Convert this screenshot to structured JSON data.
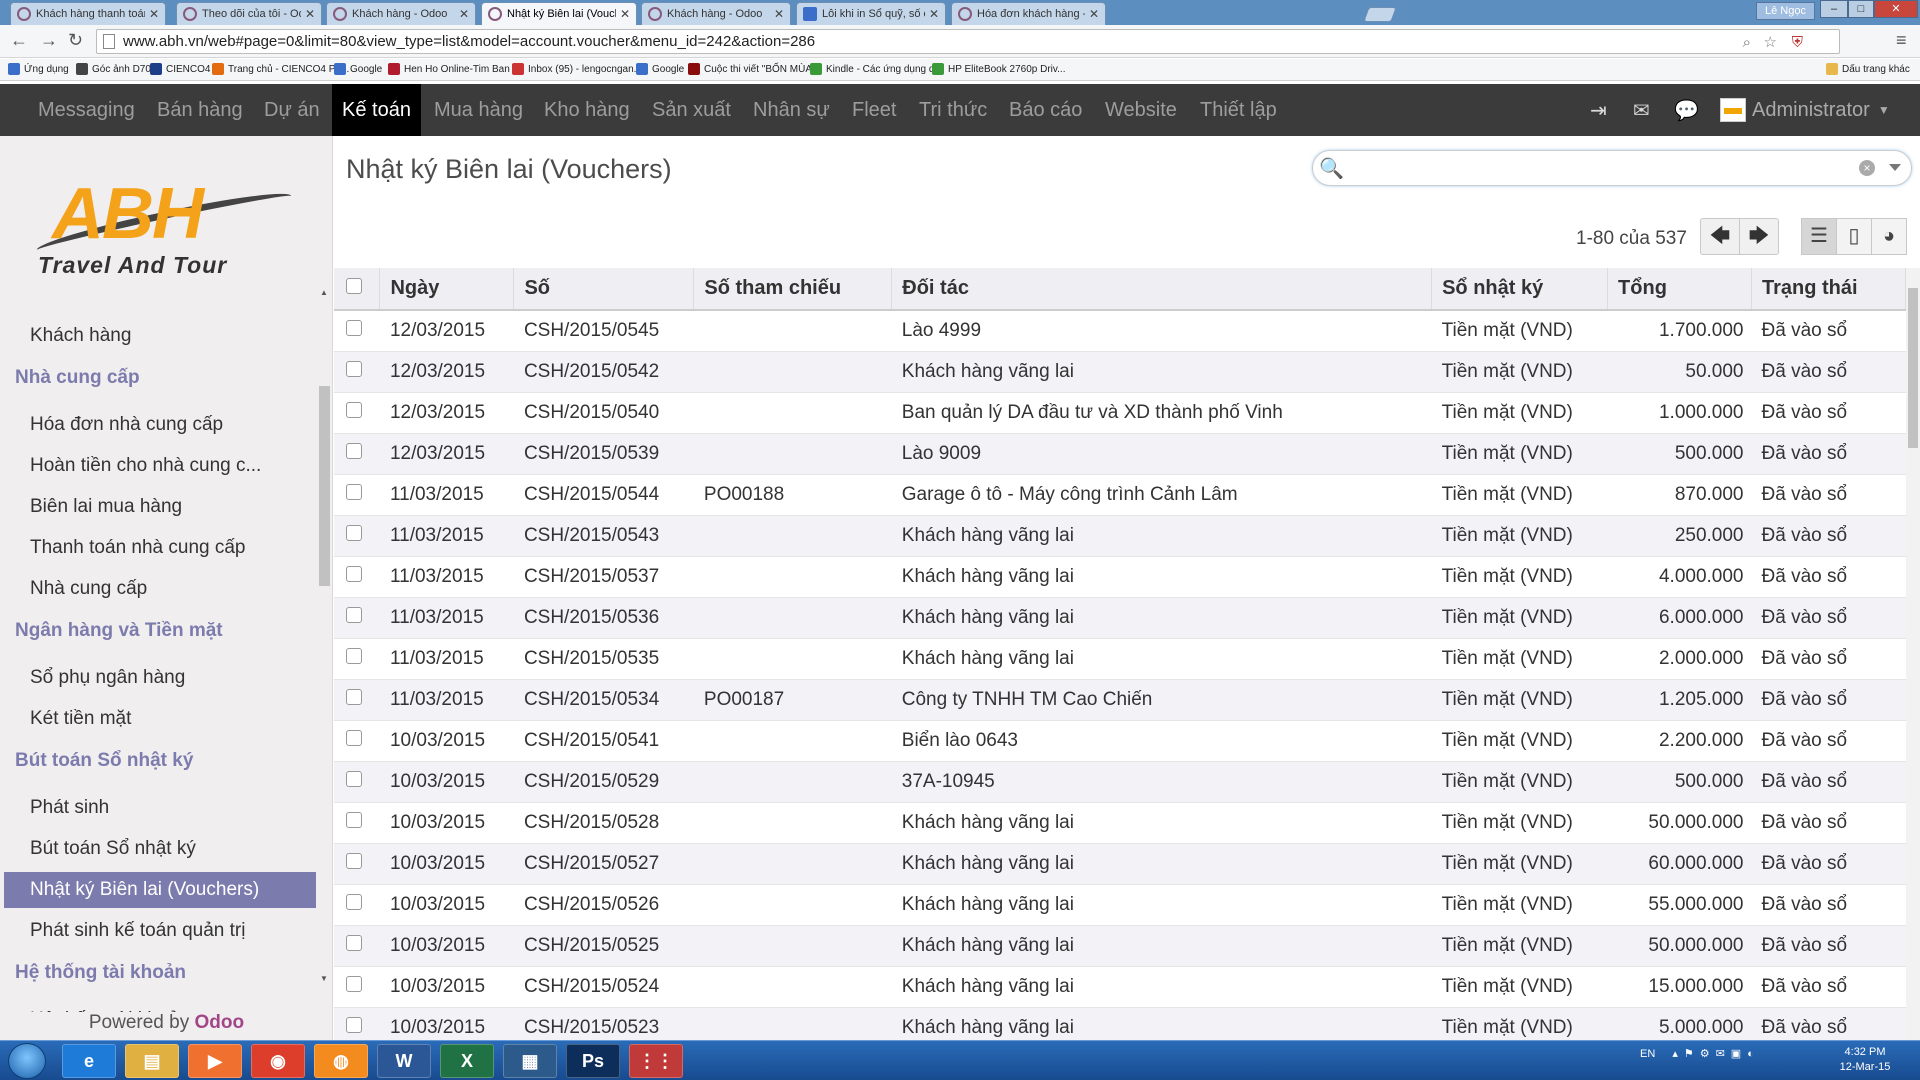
{
  "browser": {
    "tabs": [
      {
        "title": "Khách hàng thanh toán - Odoo",
        "active": false
      },
      {
        "title": "Theo dõi của tôi - Odoo",
        "active": false
      },
      {
        "title": "Khách hàng - Odoo",
        "active": false
      },
      {
        "title": "Nhật ký Biên lai (Vouchers) - O",
        "active": true
      },
      {
        "title": "Khách hàng - Odoo",
        "active": false
      },
      {
        "title": "Lỗi khi in Sổ quỹ, số cái đối với",
        "active": false
      },
      {
        "title": "Hóa đơn khách hàng - Odoo",
        "active": false
      }
    ],
    "user": "Lê Ngọc",
    "url": "www.abh.vn/web#page=0&limit=80&view_type=list&model=account.voucher&menu_id=242&action=286",
    "bookmarks": [
      "Ứng dụng",
      "Góc ảnh D700",
      "CIENCO4",
      "Trang chủ - CIENCO4 Po...",
      "Google",
      "Hen Ho Online-Tim Ban ...",
      "Inbox (95) - lengocngan...",
      "Google",
      "Cuộc thi viết \"BỐN MÙA...",
      "Kindle - Các ứng dụng d...",
      "HP EliteBook 2760p Driv...",
      "Dấu trang khác"
    ]
  },
  "topnav": {
    "menus": [
      "Messaging",
      "Bán hàng",
      "Dự án",
      "Kế toán",
      "Mua hàng",
      "Kho hàng",
      "Sản xuất",
      "Nhân sự",
      "Fleet",
      "Tri thức",
      "Báo cáo",
      "Website",
      "Thiết lập"
    ],
    "active_menu": "Kế toán",
    "user": "Administrator"
  },
  "sidebar": {
    "brand": {
      "name": "ABH",
      "tagline": "Travel And Tour"
    },
    "sections": [
      {
        "items": [
          "Khách hàng"
        ]
      },
      {
        "header": "Nhà cung cấp",
        "items": [
          "Hóa đơn nhà cung cấp",
          "Hoàn tiền cho nhà cung c...",
          "Biên lai mua hàng",
          "Thanh toán nhà cung cấp",
          "Nhà cung cấp"
        ]
      },
      {
        "header": "Ngân hàng và Tiền mặt",
        "items": [
          "Sổ phụ ngân hàng",
          "Két tiền mặt"
        ]
      },
      {
        "header": "Bút toán Sổ nhật ký",
        "items": [
          "Phát sinh",
          "Bút toán Sổ nhật ký",
          "Nhật ký Biên lai (Vouchers)",
          "Phát sinh kế toán quản trị"
        ]
      },
      {
        "header": "Hệ thống tài khoản",
        "items": [
          "Hệ thống tài khoản"
        ]
      }
    ],
    "active_item": "Nhật ký Biên lai (Vouchers)",
    "powered_prefix": "Powered by",
    "powered_brand": "Odoo"
  },
  "main": {
    "title": "Nhật ký Biên lai (Vouchers)",
    "pager": "1-80 của 537",
    "columns": [
      "Ngày",
      "Số",
      "Số tham chiếu",
      "Đối tác",
      "Sổ nhật ký",
      "Tổng",
      "Trạng thái"
    ],
    "rows": [
      [
        "12/03/2015",
        "CSH/2015/0545",
        "",
        "Lào 4999",
        "Tiền mặt (VND)",
        "1.700.000",
        "Đã vào sổ"
      ],
      [
        "12/03/2015",
        "CSH/2015/0542",
        "",
        "Khách hàng vãng lai",
        "Tiền mặt (VND)",
        "50.000",
        "Đã vào sổ"
      ],
      [
        "12/03/2015",
        "CSH/2015/0540",
        "",
        "Ban quản lý DA đầu tư và XD thành phố Vinh",
        "Tiền mặt (VND)",
        "1.000.000",
        "Đã vào sổ"
      ],
      [
        "12/03/2015",
        "CSH/2015/0539",
        "",
        "Lào 9009",
        "Tiền mặt (VND)",
        "500.000",
        "Đã vào sổ"
      ],
      [
        "11/03/2015",
        "CSH/2015/0544",
        "PO00188",
        "Garage ô tô - Máy công trình Cảnh Lâm",
        "Tiền mặt (VND)",
        "870.000",
        "Đã vào sổ"
      ],
      [
        "11/03/2015",
        "CSH/2015/0543",
        "",
        "Khách hàng vãng lai",
        "Tiền mặt (VND)",
        "250.000",
        "Đã vào sổ"
      ],
      [
        "11/03/2015",
        "CSH/2015/0537",
        "",
        "Khách hàng vãng lai",
        "Tiền mặt (VND)",
        "4.000.000",
        "Đã vào sổ"
      ],
      [
        "11/03/2015",
        "CSH/2015/0536",
        "",
        "Khách hàng vãng lai",
        "Tiền mặt (VND)",
        "6.000.000",
        "Đã vào sổ"
      ],
      [
        "11/03/2015",
        "CSH/2015/0535",
        "",
        "Khách hàng vãng lai",
        "Tiền mặt (VND)",
        "2.000.000",
        "Đã vào sổ"
      ],
      [
        "11/03/2015",
        "CSH/2015/0534",
        "PO00187",
        "Công ty TNHH TM Cao Chiến",
        "Tiền mặt (VND)",
        "1.205.000",
        "Đã vào sổ"
      ],
      [
        "10/03/2015",
        "CSH/2015/0541",
        "",
        "Biển lào 0643",
        "Tiền mặt (VND)",
        "2.200.000",
        "Đã vào sổ"
      ],
      [
        "10/03/2015",
        "CSH/2015/0529",
        "",
        "37A-10945",
        "Tiền mặt (VND)",
        "500.000",
        "Đã vào sổ"
      ],
      [
        "10/03/2015",
        "CSH/2015/0528",
        "",
        "Khách hàng vãng lai",
        "Tiền mặt (VND)",
        "50.000.000",
        "Đã vào sổ"
      ],
      [
        "10/03/2015",
        "CSH/2015/0527",
        "",
        "Khách hàng vãng lai",
        "Tiền mặt (VND)",
        "60.000.000",
        "Đã vào sổ"
      ],
      [
        "10/03/2015",
        "CSH/2015/0526",
        "",
        "Khách hàng vãng lai",
        "Tiền mặt (VND)",
        "55.000.000",
        "Đã vào sổ"
      ],
      [
        "10/03/2015",
        "CSH/2015/0525",
        "",
        "Khách hàng vãng lai",
        "Tiền mặt (VND)",
        "50.000.000",
        "Đã vào sổ"
      ],
      [
        "10/03/2015",
        "CSH/2015/0524",
        "",
        "Khách hàng vãng lai",
        "Tiền mặt (VND)",
        "15.000.000",
        "Đã vào sổ"
      ],
      [
        "10/03/2015",
        "CSH/2015/0523",
        "",
        "Khách hàng vãng lai",
        "Tiền mặt (VND)",
        "5.000.000",
        "Đã vào sổ"
      ]
    ]
  },
  "taskbar": {
    "lang": "EN",
    "time": "4:32 PM",
    "date": "12-Mar-15",
    "apps": [
      "ie-icon",
      "explorer-icon",
      "media-icon",
      "chrome-icon",
      "firefox-icon",
      "word-icon",
      "excel-icon",
      "app-icon",
      "photoshop-icon",
      "apps-grid-icon"
    ]
  },
  "colors": {
    "accent": "#7c7bad",
    "topnav": "#3b3b3b",
    "odoo": "#a24689",
    "brand_orange": "#f4a21a"
  }
}
